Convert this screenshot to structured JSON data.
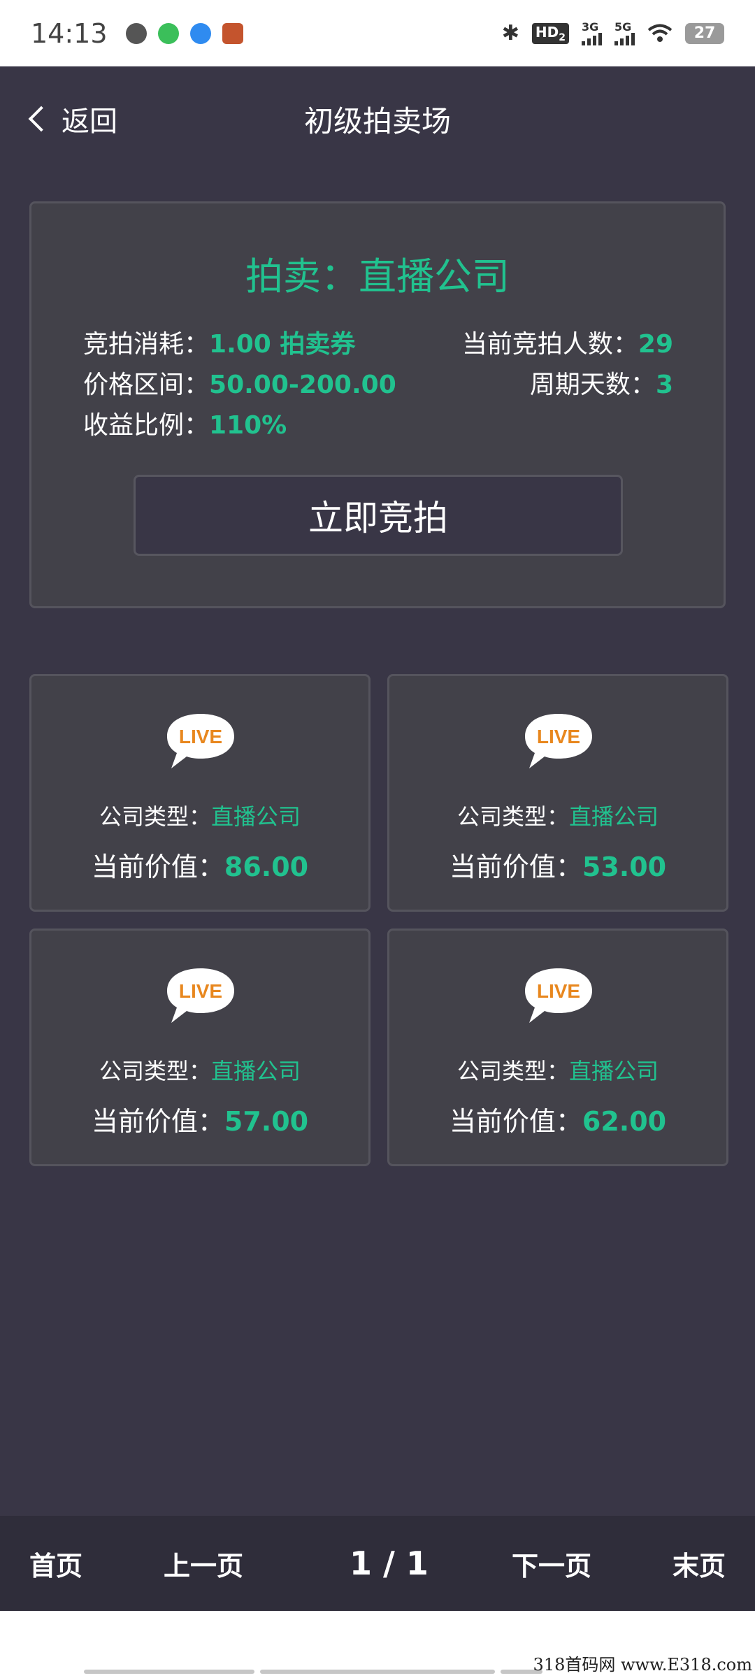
{
  "status_bar": {
    "time": "14:13",
    "hd_label": "HD",
    "hd_sub": "2",
    "net1": "3G",
    "net2": "5G",
    "battery": "27"
  },
  "nav": {
    "back_label": "返回",
    "title": "初级拍卖场"
  },
  "auction": {
    "heading": "拍卖：直播公司",
    "cost_label": "竞拍消耗：",
    "cost_value": "1.00 拍卖券",
    "bidders_label": "当前竞拍人数：",
    "bidders_value": "29",
    "price_label": "价格区间：",
    "price_value": "50.00-200.00",
    "cycle_label": "周期天数：",
    "cycle_value": "3",
    "return_label": "收益比例：",
    "return_value": "110%",
    "bid_button": "立即竞拍"
  },
  "companies": [
    {
      "type_label": "公司类型：",
      "type_value": "直播公司",
      "value_label": "当前价值：",
      "value": "86.00"
    },
    {
      "type_label": "公司类型：",
      "type_value": "直播公司",
      "value_label": "当前价值：",
      "value": "53.00"
    },
    {
      "type_label": "公司类型：",
      "type_value": "直播公司",
      "value_label": "当前价值：",
      "value": "57.00"
    },
    {
      "type_label": "公司类型：",
      "type_value": "直播公司",
      "value_label": "当前价值：",
      "value": "62.00"
    }
  ],
  "icon": {
    "name": "live-icon",
    "text": "LIVE",
    "color": "#e8871e"
  },
  "pager": {
    "first": "首页",
    "prev": "上一页",
    "indicator": "1 / 1",
    "next": "下一页",
    "last": "末页"
  },
  "watermark": "318首码网 www.E318.com",
  "colors": {
    "accent": "#21c28f",
    "background": "#393646",
    "card": "#424149"
  }
}
